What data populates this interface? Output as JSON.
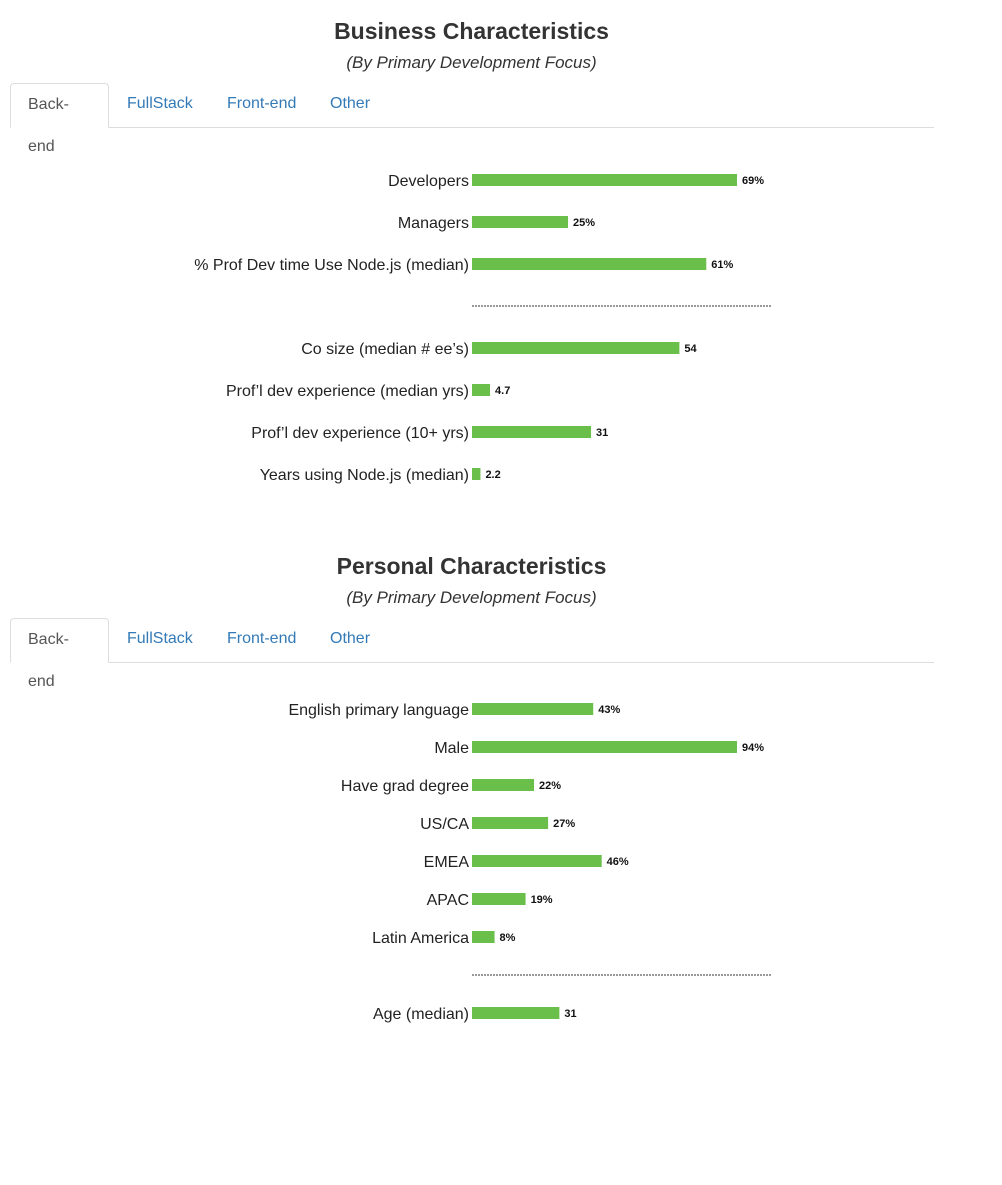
{
  "colors": {
    "bar": "#6abf4b",
    "tab_link": "#337ab7",
    "tab_active": "#555555"
  },
  "sections": [
    {
      "title": "Business Characteristics",
      "subtitle": "(By Primary Development Focus)",
      "tabs": [
        "Back-end",
        "FullStack",
        "Front-end",
        "Other"
      ],
      "active_tab": "Back-end"
    },
    {
      "title": "Personal Characteristics",
      "subtitle": "(By Primary Development Focus)",
      "tabs": [
        "Back-end",
        "FullStack",
        "Front-end",
        "Other"
      ],
      "active_tab": "Back-end"
    }
  ],
  "chart_data": [
    {
      "type": "bar",
      "orientation": "horizontal",
      "groups": [
        {
          "categories": [
            "Developers",
            "Managers",
            "% Prof Dev time Use Node.js (median)"
          ],
          "values": [
            69,
            25,
            61
          ],
          "labels": [
            "69%",
            "25%",
            "61%"
          ]
        },
        {
          "categories": [
            "Co size (median # ee’s)",
            "Prof’l dev experience (median yrs)",
            "Prof’l dev experience (10+ yrs)",
            "Years using Node.js (median)"
          ],
          "values": [
            54,
            4.7,
            31,
            2.2
          ],
          "labels": [
            "54",
            "4.7",
            "31",
            "2.2"
          ]
        }
      ],
      "xlim": [
        0,
        69
      ],
      "grid": false,
      "legend": "none"
    },
    {
      "type": "bar",
      "orientation": "horizontal",
      "groups": [
        {
          "categories": [
            "English primary language",
            "Male",
            "Have grad degree",
            "US/CA",
            "EMEA",
            "APAC",
            "Latin America"
          ],
          "values": [
            43,
            94,
            22,
            27,
            46,
            19,
            8
          ],
          "labels": [
            "43%",
            "94%",
            "22%",
            "27%",
            "46%",
            "19%",
            "8%"
          ]
        },
        {
          "categories": [
            "Age (median)"
          ],
          "values": [
            31
          ],
          "labels": [
            "31"
          ]
        }
      ],
      "xlim": [
        0,
        94
      ],
      "grid": false,
      "legend": "none"
    }
  ]
}
